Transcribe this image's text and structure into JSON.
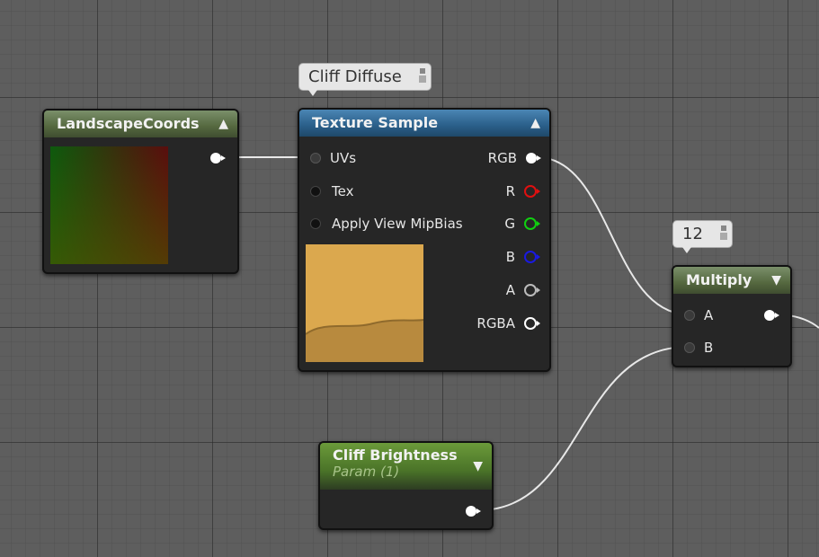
{
  "nodes": {
    "landscape_coords": {
      "title": "LandscapeCoords"
    },
    "texture_sample": {
      "title": "Texture Sample",
      "comment": "Cliff Diffuse",
      "inputs": [
        "UVs",
        "Tex",
        "Apply View MipBias"
      ],
      "outputs": [
        "RGB",
        "R",
        "G",
        "B",
        "A",
        "RGBA"
      ]
    },
    "multiply": {
      "title": "Multiply",
      "comment": "12",
      "inputs": [
        "A",
        "B"
      ]
    },
    "cliff_brightness": {
      "title": "Cliff Brightness",
      "subtitle": "Param (1)"
    }
  },
  "colors": {
    "pin_r": "#e01010",
    "pin_g": "#10d010",
    "pin_b": "#1a1ae0",
    "pin_a": "#bbbbbb",
    "pin_rgba": "#ffffff",
    "texture_preview": "#dba84e"
  },
  "icons": [
    "collapse-up-arrow-icon",
    "collapse-down-arrow-icon",
    "pin-icon"
  ]
}
